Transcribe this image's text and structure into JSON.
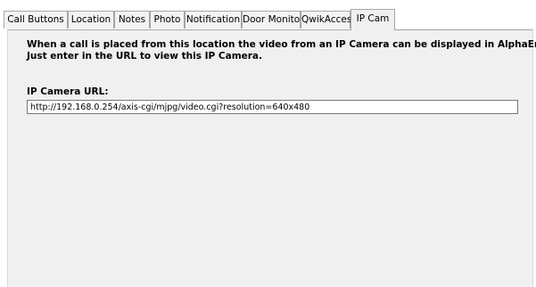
{
  "tabs": [
    {
      "label": "Call Buttons"
    },
    {
      "label": "Location"
    },
    {
      "label": "Notes"
    },
    {
      "label": "Photo"
    },
    {
      "label": "Notification"
    },
    {
      "label": "Door Monitor"
    },
    {
      "label": "QwikAccess"
    },
    {
      "label": "IP Cam",
      "active": true
    }
  ],
  "ipcam": {
    "description_line1": "When a call is placed from this location the video from an IP Camera can be displayed in AlphaEntry.",
    "description_line2": "Just enter in the URL to view this IP Camera.",
    "url_label": "IP Camera URL:",
    "url_value": "http://192.168.0.254/axis-cgi/mjpg/video.cgi?resolution=640x480"
  }
}
